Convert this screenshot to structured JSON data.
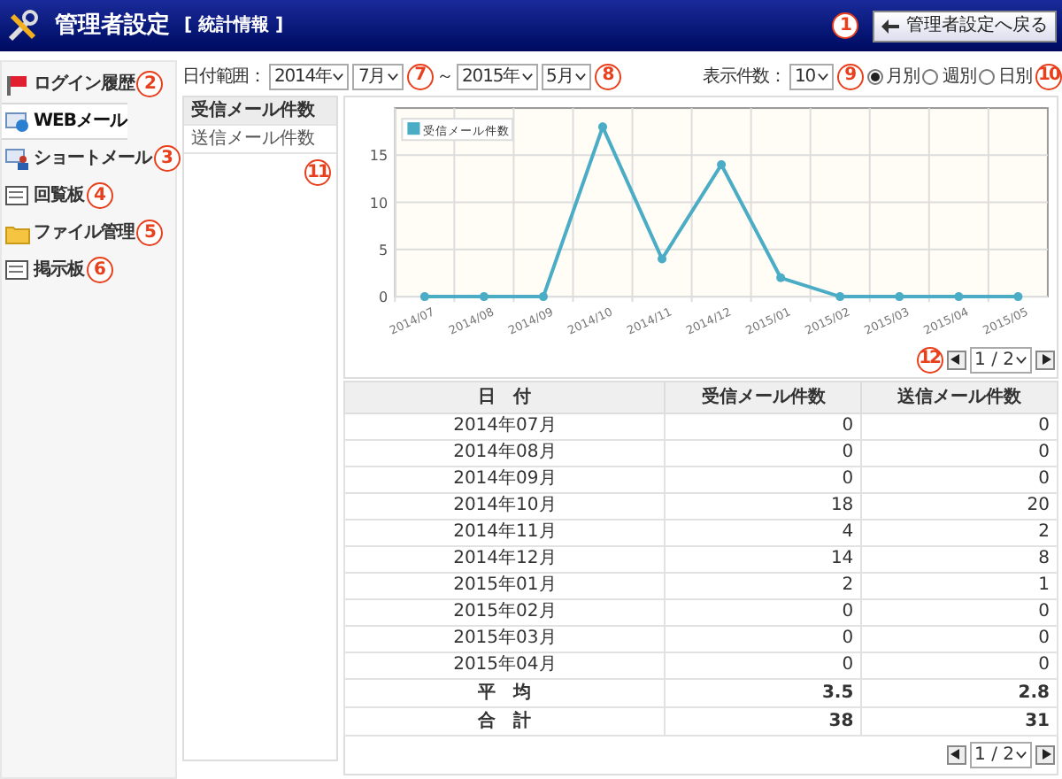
{
  "header": {
    "title": "管理者設定",
    "subtitle": "[ 統計情報 ]",
    "back_button": "管理者設定へ戻る"
  },
  "sidebar": {
    "items": [
      {
        "label": "ログイン履歴",
        "selected": false
      },
      {
        "label": "WEBメール",
        "selected": true
      },
      {
        "label": "ショートメール",
        "selected": false
      },
      {
        "label": "回覧板",
        "selected": false
      },
      {
        "label": "ファイル管理",
        "selected": false
      },
      {
        "label": "掲示板",
        "selected": false
      }
    ]
  },
  "date_range": {
    "label": "日付範囲：",
    "from_year": "2014年",
    "from_month": "7月",
    "separator": "～",
    "to_year": "2015年",
    "to_month": "5月"
  },
  "display_count": {
    "label": "表示件数：",
    "value": "10"
  },
  "period": [
    {
      "label": "月別",
      "selected": true
    },
    {
      "label": "週別",
      "selected": false
    },
    {
      "label": "日別",
      "selected": false
    }
  ],
  "metrics": [
    {
      "label": "受信メール件数",
      "selected": true
    },
    {
      "label": "送信メール件数",
      "selected": false
    }
  ],
  "chart": {
    "chart_data": {
      "type": "line",
      "grid": true,
      "categories": [
        "2014/07",
        "2014/08",
        "2014/09",
        "2014/10",
        "2014/11",
        "2014/12",
        "2015/01",
        "2015/02",
        "2015/03",
        "2015/04",
        "2015/05"
      ],
      "ylim": [
        0,
        20
      ],
      "yticks": [
        0,
        5,
        10,
        15
      ],
      "series": [
        {
          "name": "受信メール件数",
          "color": "#4bacc6",
          "marker": true,
          "values": [
            0,
            0,
            0,
            18,
            4,
            14,
            2,
            0,
            0,
            0,
            0
          ]
        }
      ]
    }
  },
  "pager_top": {
    "page": "1 / 2"
  },
  "table": {
    "columns": [
      "日　付",
      "受信メール件数",
      "送信メール件数"
    ],
    "rows": [
      [
        "2014年07月",
        "0",
        "0"
      ],
      [
        "2014年08月",
        "0",
        "0"
      ],
      [
        "2014年09月",
        "0",
        "0"
      ],
      [
        "2014年10月",
        "18",
        "20"
      ],
      [
        "2014年11月",
        "4",
        "2"
      ],
      [
        "2014年12月",
        "14",
        "8"
      ],
      [
        "2015年01月",
        "2",
        "1"
      ],
      [
        "2015年02月",
        "0",
        "0"
      ],
      [
        "2015年03月",
        "0",
        "0"
      ],
      [
        "2015年04月",
        "0",
        "0"
      ]
    ],
    "summary": [
      [
        "平　均",
        "3.5",
        "2.8"
      ],
      [
        "合　計",
        "38",
        "31"
      ]
    ]
  },
  "pager_bottom": {
    "page": "1 / 2"
  },
  "callouts": [
    "1",
    "2",
    "3",
    "4",
    "5",
    "6",
    "7",
    "8",
    "9",
    "10",
    "11",
    "12"
  ]
}
